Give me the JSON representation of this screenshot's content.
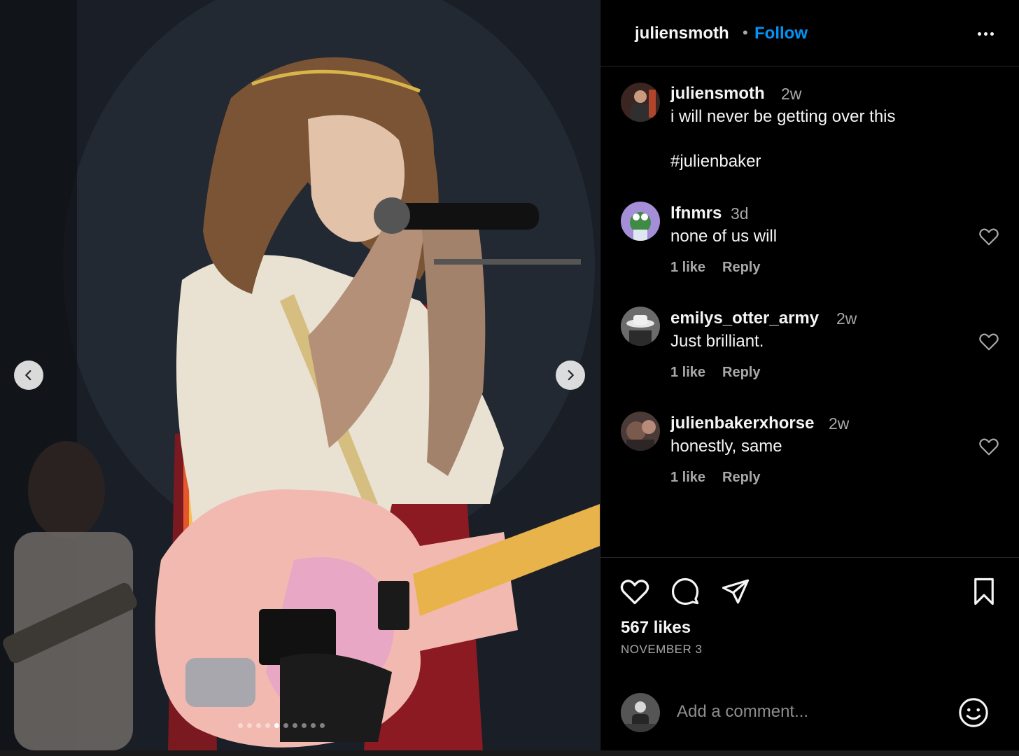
{
  "header": {
    "username": "juliensmoth",
    "separator": "•",
    "follow_label": "Follow",
    "more_icon": "more-horizontal-icon"
  },
  "caption": {
    "username": "juliensmoth",
    "time": "2w",
    "line1": "i will never be getting over this",
    "hashtag": "#julienbaker"
  },
  "comments": [
    {
      "username": "lfnmrs",
      "time": "3d",
      "text": "none of us will",
      "likes": "1 like",
      "reply": "Reply"
    },
    {
      "username": "emilys_otter_army",
      "time": "2w",
      "text": "Just brilliant.",
      "likes": "1 like",
      "reply": "Reply"
    },
    {
      "username": "julienbakerxhorse",
      "time": "2w",
      "text": "honestly, same",
      "likes": "1 like",
      "reply": "Reply"
    }
  ],
  "actions": {
    "like_icon": "heart-outline-icon",
    "comment_icon": "comment-bubble-icon",
    "share_icon": "paper-plane-icon",
    "save_icon": "bookmark-icon"
  },
  "stats": {
    "likes": "567 likes",
    "date": "NOVEMBER 3"
  },
  "composer": {
    "placeholder": "Add a comment...",
    "emoji_icon": "smiley-icon"
  },
  "carousel": {
    "slide_count": 10,
    "active_index": 4
  },
  "colors": {
    "accent": "#0095f6",
    "background": "#000000",
    "text_primary": "#f5f5f5",
    "text_secondary": "#a8a8a8"
  }
}
